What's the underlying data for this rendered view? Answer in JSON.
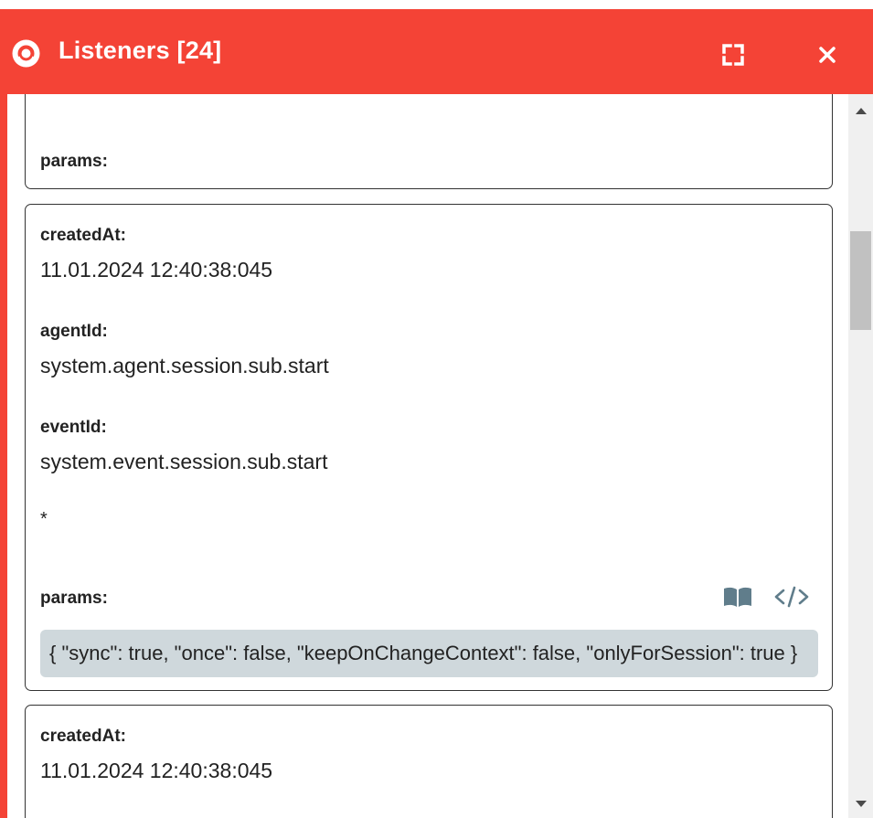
{
  "header": {
    "title": "Listeners [24]",
    "logo_icon": "eye-icon",
    "fullscreen_icon": "fullscreen-icon",
    "close_icon": "close-icon",
    "color": "#f44336"
  },
  "cards": [
    {
      "params_label": "params:"
    },
    {
      "created_label": "createdAt:",
      "created_value": "11.01.2024 12:40:38:045",
      "agent_label": "agentId:",
      "agent_value": "system.agent.session.sub.start",
      "event_label": "eventId:",
      "event_value": "system.event.session.sub.start",
      "marker": "*",
      "params_label": "params:",
      "params_value": "{ \"sync\": true, \"once\": false, \"keepOnChangeContext\": false, \"onlyForSession\": true }",
      "params_icons": [
        "book-icon",
        "code-icon"
      ]
    },
    {
      "created_label": "createdAt:",
      "created_value": "11.01.2024 12:40:38:045"
    }
  ],
  "params_box_color": "#cfd8dc"
}
